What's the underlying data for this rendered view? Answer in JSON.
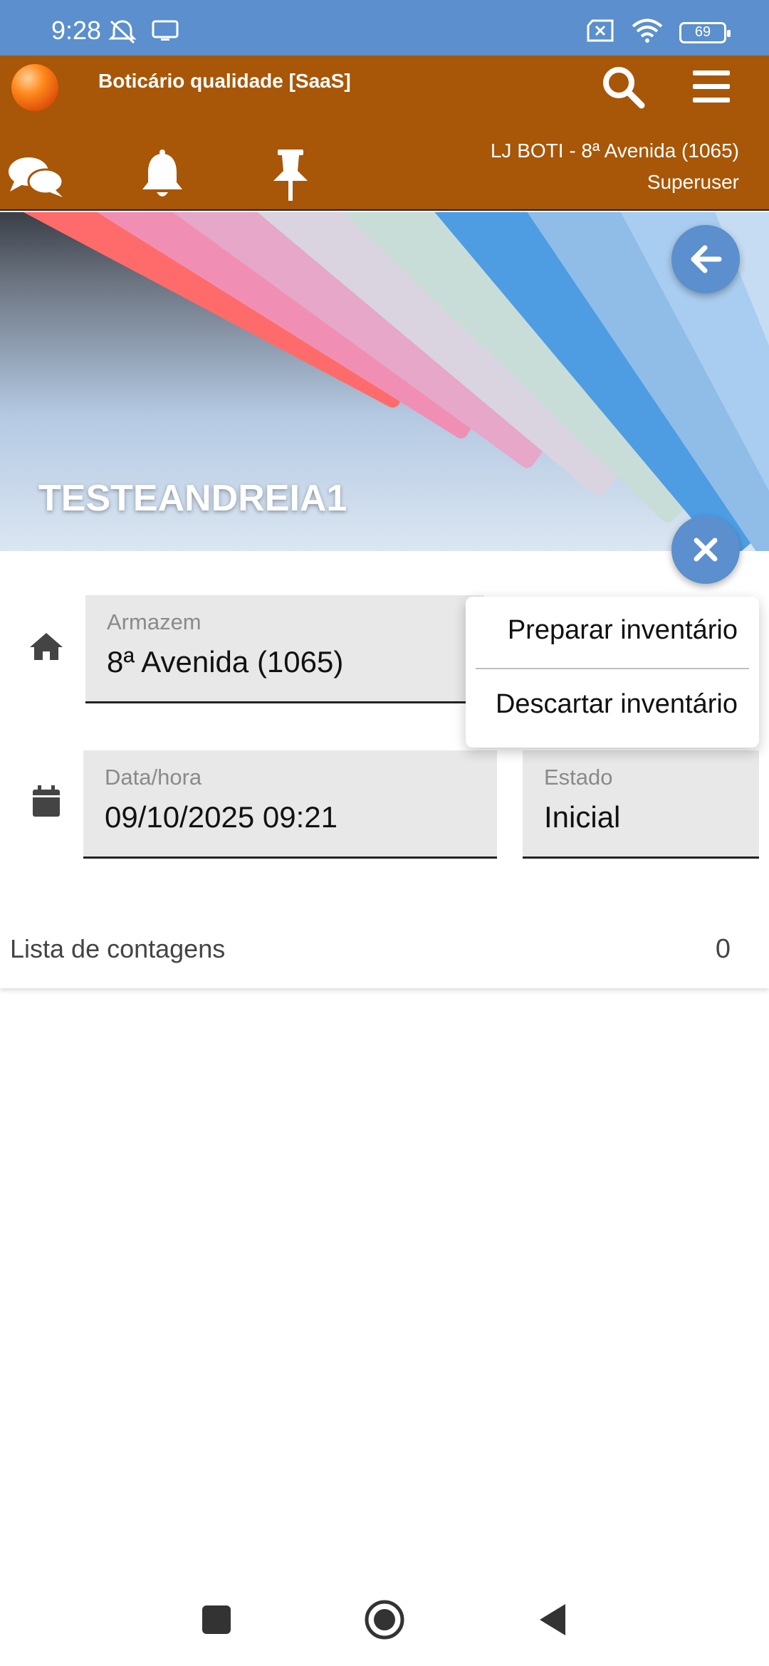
{
  "status_bar": {
    "time": "9:28",
    "battery": "69",
    "icons": [
      "mute-alarm-icon",
      "cast-icon",
      "sim-error-icon",
      "wifi-icon",
      "battery-icon"
    ]
  },
  "header": {
    "app_title": "Boticário qualidade [SaaS]",
    "store": "LJ BOTI - 8ª Avenida (1065)",
    "user": "Superuser",
    "colors": {
      "header_bg": "#a85607",
      "accent": "#5b8fcd"
    }
  },
  "banner": {
    "title": "TESTEANDREIA1"
  },
  "form": {
    "warehouse": {
      "label": "Armazem",
      "value": "8ª Avenida (1065)"
    },
    "datetime": {
      "label": "Data/hora",
      "value": "09/10/2025 09:21"
    },
    "state": {
      "label": "Estado",
      "value": "Inicial"
    }
  },
  "menu": {
    "items": [
      "Preparar inventário",
      "Descartar inventário"
    ]
  },
  "counts": {
    "label": "Lista de contagens",
    "value": "0"
  }
}
